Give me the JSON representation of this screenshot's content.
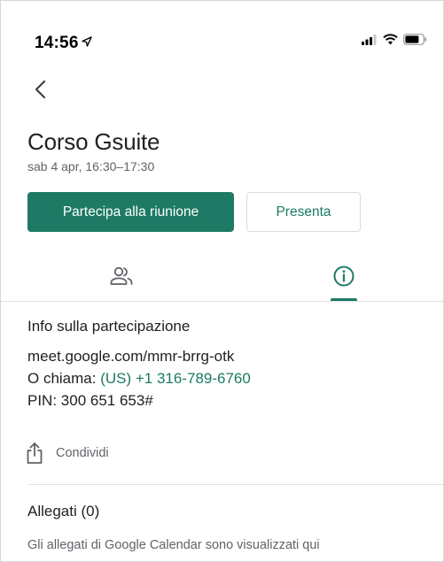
{
  "status_bar": {
    "time": "14:56"
  },
  "event": {
    "title": "Corso Gsuite",
    "date": "sab 4 apr, 16:30–17:30"
  },
  "actions": {
    "join_label": "Partecipa alla riunione",
    "present_label": "Presenta"
  },
  "tabs": [
    {
      "icon": "people-icon",
      "selected": false
    },
    {
      "icon": "info-icon",
      "selected": true
    }
  ],
  "info": {
    "heading": "Info sulla partecipazione",
    "meet_link": "meet.google.com/mmr-brrg-otk",
    "call_prefix": "O chiama: ",
    "phone": "(US) +1 316-789-6760",
    "pin": "PIN: 300 651 653#"
  },
  "share": {
    "label": "Condividi"
  },
  "attachments": {
    "heading": "Allegati (0)",
    "note": "Gli allegati di Google Calendar sono visualizzati qui"
  },
  "colors": {
    "accent": "#1e7a64",
    "link": "#1a7a62",
    "secondary_text": "#5f6368",
    "divider": "#e0e0e0"
  }
}
